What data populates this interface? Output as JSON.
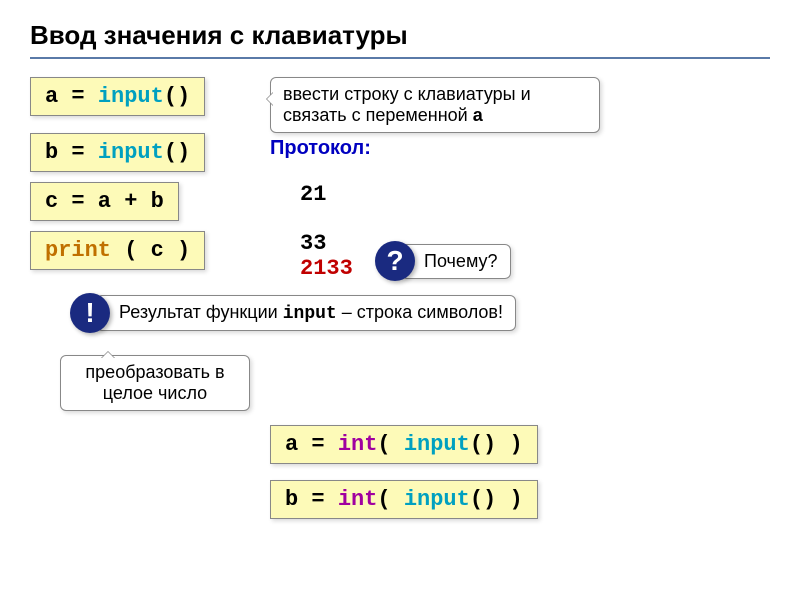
{
  "title": "Ввод значения с клавиатуры",
  "code": {
    "line1_a": "a = ",
    "line1_func": "input",
    "line1_end": "()",
    "line2_a": "b = ",
    "line2_func": "input",
    "line2_end": "()",
    "line3": "c = a + b",
    "line4_func": "print",
    "line4_rest": " ( c )",
    "int_a_pre": "a = ",
    "int_a_int": "int",
    "int_a_mid": "( ",
    "int_a_input": "input",
    "int_a_end": "() )",
    "int_b_pre": "b = ",
    "int_b_int": "int",
    "int_b_mid": "( ",
    "int_b_input": "input",
    "int_b_end": "() )"
  },
  "callouts": {
    "enter_string": "ввести строку с клавиатуры и связать с переменной ",
    "enter_string_var": "a",
    "protocol_label": "Протокол:",
    "proto1": "21",
    "proto2": "33",
    "proto3": "2133",
    "why": "Почему?",
    "result_note_pre": "Результат функции ",
    "result_note_kw": "input",
    "result_note_post": " – строка символов!",
    "convert": "преобразовать в целое число"
  },
  "badges": {
    "question": "?",
    "exclaim": "!"
  }
}
